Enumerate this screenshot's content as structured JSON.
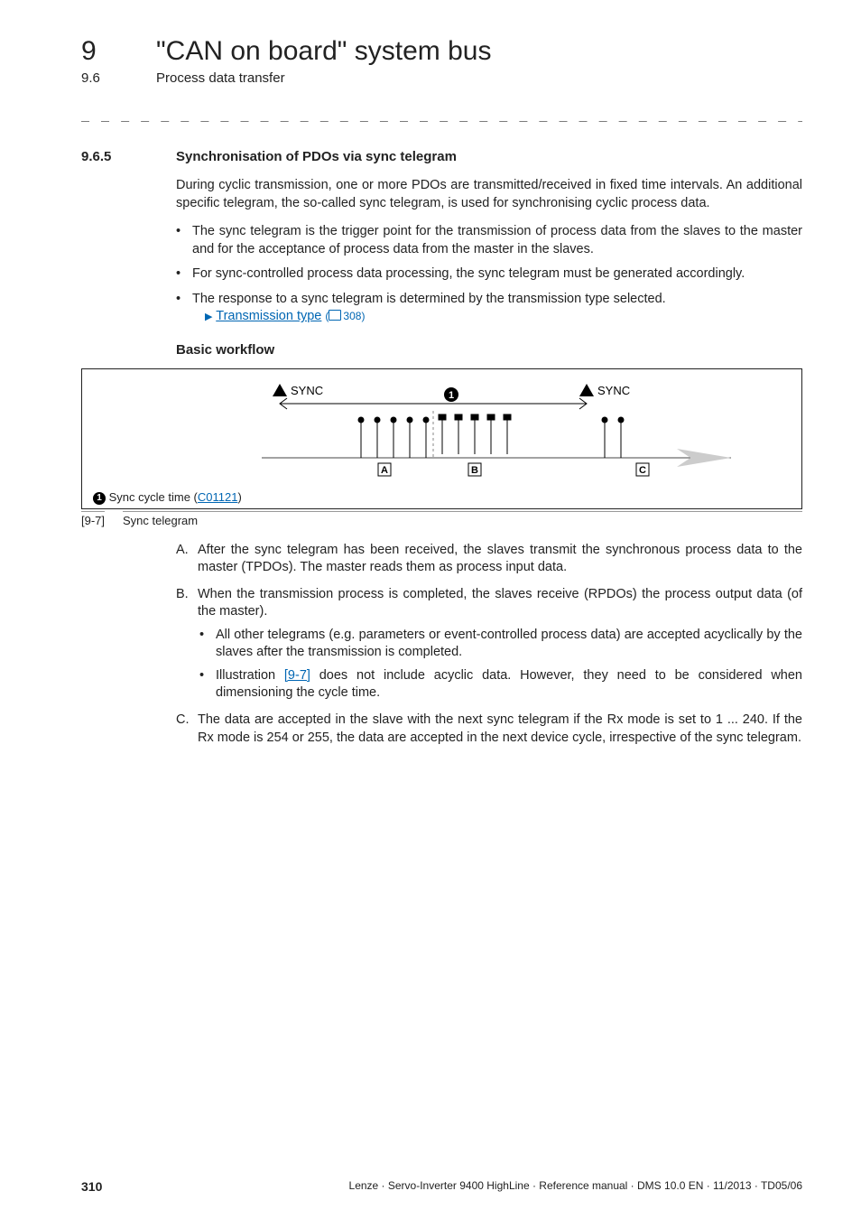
{
  "header": {
    "chapter_num": "9",
    "chapter_title": "\"CAN on board\" system bus",
    "section_num": "9.6",
    "section_title": "Process data transfer",
    "separator": "_ _ _ _ _ _ _ _ _ _ _ _ _ _ _ _ _ _ _ _ _ _ _ _ _ _ _ _ _ _ _ _ _ _ _ _ _ _ _ _ _ _ _ _ _ _ _ _ _ _ _ _ _ _ _ _ _ _ _ _ _ _ _ _"
  },
  "subsection": {
    "num": "9.6.5",
    "title": "Synchronisation of PDOs via sync telegram"
  },
  "intro_para": "During cyclic transmission, one or more PDOs are transmitted/received in fixed time intervals. An additional specific telegram, the so-called sync telegram, is used for synchronising cyclic process data.",
  "bullets": {
    "b1": "The sync telegram is the trigger point for the transmission of process data from the slaves to the master and for the acceptance of process data from the master in the slaves.",
    "b2": "For sync-controlled process data processing, the sync telegram must be generated accordingly.",
    "b3": "The response to a sync telegram is determined by the transmission type selected.",
    "b3_link": "Transmission type",
    "b3_page": "308"
  },
  "subhead": "Basic workflow",
  "figure": {
    "sync_label": "SYNC",
    "a": "A",
    "b": "B",
    "c": "C",
    "marker": "1",
    "footer_pre": "Sync cycle time (",
    "footer_link": "C01121",
    "footer_post": ")"
  },
  "caption": {
    "num": "[9-7]",
    "text": "Sync telegram"
  },
  "list": {
    "A_marker": "A.",
    "A": "After the sync telegram has been received, the slaves transmit the synchronous process data to the master (TPDOs). The master reads them as process input data.",
    "B_marker": "B.",
    "B": "When the transmission process is completed, the slaves receive (RPDOs) the process output data (of the master).",
    "B_sub1": "All other telegrams (e.g. parameters or event-controlled process data) are accepted acyclically by the slaves after the transmission is completed.",
    "B_sub2_pre": "Illustration ",
    "B_sub2_link": "[9-7]",
    "B_sub2_post": " does not include acyclic data. However, they need to be considered when dimensioning the cycle time.",
    "C_marker": "C.",
    "C": "The data are accepted in the slave with the next sync telegram if the Rx mode is set to 1 ... 240. If the Rx mode is 254 or 255, the data are accepted in the next device cycle, irrespective of the sync telegram."
  },
  "footer": {
    "page": "310",
    "imprint": "Lenze · Servo-Inverter 9400 HighLine · Reference manual · DMS 10.0 EN · 11/2013 · TD05/06"
  }
}
